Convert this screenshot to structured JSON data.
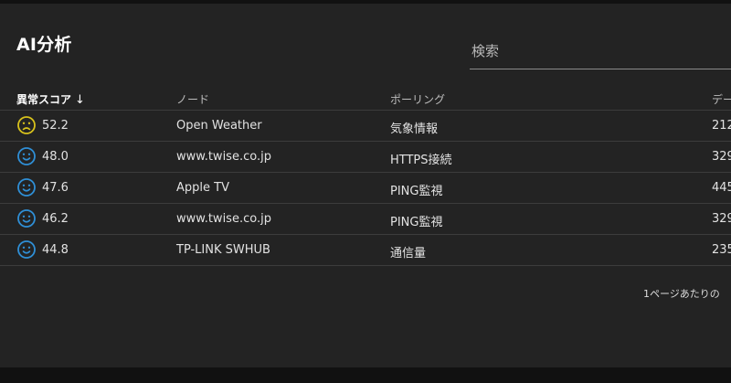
{
  "header": {
    "title": "AI分析",
    "search_placeholder": "検索"
  },
  "table": {
    "columns": [
      "異常スコア",
      "ノード",
      "ポーリング",
      "デー"
    ],
    "sort": {
      "column": "異常スコア",
      "direction": "desc"
    },
    "rows": [
      {
        "score": "52.2",
        "face": "sad",
        "node": "Open Weather",
        "polling": "気象情報",
        "data": "212"
      },
      {
        "score": "48.0",
        "face": "happy",
        "node": "www.twise.co.jp",
        "polling": "HTTPS接続",
        "data": "329"
      },
      {
        "score": "47.6",
        "face": "happy",
        "node": "Apple TV",
        "polling": "PING監視",
        "data": "445"
      },
      {
        "score": "46.2",
        "face": "happy",
        "node": "www.twise.co.jp",
        "polling": "PING監視",
        "data": "329"
      },
      {
        "score": "44.8",
        "face": "happy",
        "node": "TP-LINK SWHUB",
        "polling": "通信量",
        "data": "235"
      }
    ]
  },
  "footer": {
    "rows_per_page_label": "1ページあたりの"
  },
  "colors": {
    "sad_face": "#d8c21c",
    "happy_face": "#2f8fd6",
    "panel": "#232323"
  }
}
